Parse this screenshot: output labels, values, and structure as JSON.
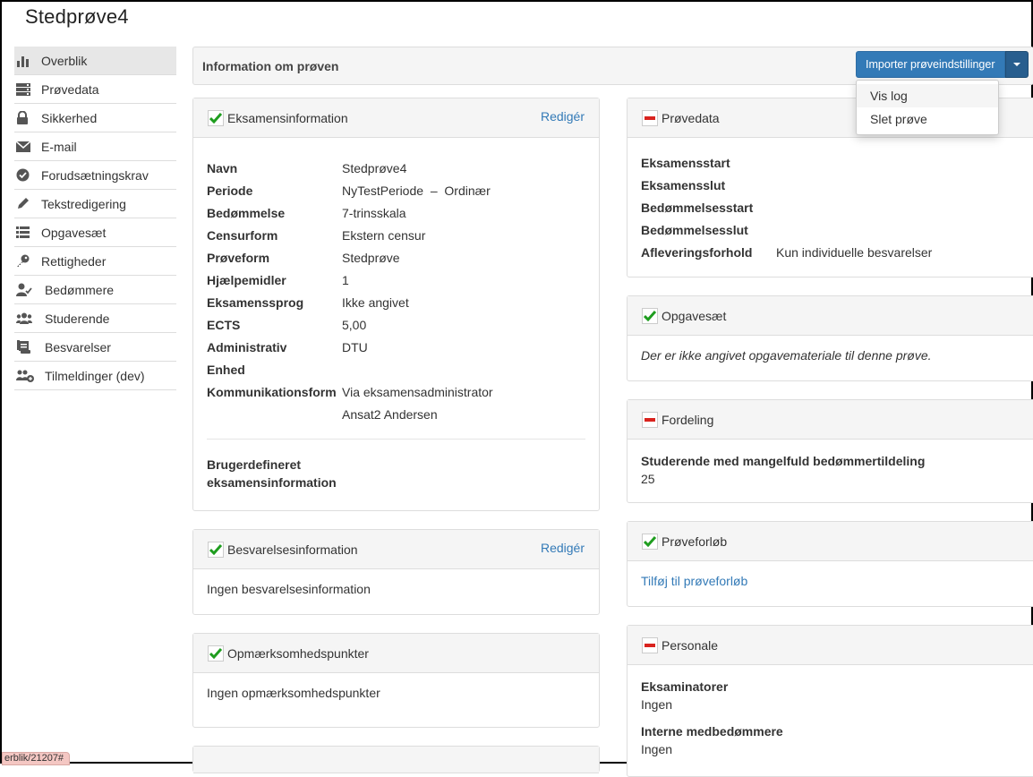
{
  "page": {
    "title": "Stedprøve4"
  },
  "sidebar": {
    "items": [
      {
        "label": "Overblik",
        "icon": "bar-chart-icon",
        "active": true
      },
      {
        "label": "Prøvedata",
        "icon": "server-icon"
      },
      {
        "label": "Sikkerhed",
        "icon": "lock-icon"
      },
      {
        "label": "E-mail",
        "icon": "envelope-icon"
      },
      {
        "label": "Forudsætningskrav",
        "icon": "badge-icon"
      },
      {
        "label": "Tekstredigering",
        "icon": "pencil-icon"
      },
      {
        "label": "Opgavesæt",
        "icon": "list-icon"
      },
      {
        "label": "Rettigheder",
        "icon": "key-icon"
      },
      {
        "label": "Bedømmere",
        "icon": "user-check-icon"
      },
      {
        "label": "Studerende",
        "icon": "users-icon"
      },
      {
        "label": "Besvarelser",
        "icon": "scroll-icon"
      },
      {
        "label": "Tilmeldinger (dev)",
        "icon": "users-plus-icon"
      }
    ]
  },
  "info_bar": {
    "title": "Information om prøven",
    "import_button": "Importer prøveindstillinger"
  },
  "dropdown": {
    "items": [
      "Vis log",
      "Slet prøve"
    ]
  },
  "exam_info": {
    "title": "Eksamensinformation",
    "edit": "Redigér",
    "rows": [
      {
        "k": "Navn",
        "v": "Stedprøve4"
      },
      {
        "k": "Periode",
        "v": "NyTestPeriode  –  Ordinær"
      },
      {
        "k": "Bedømmelse",
        "v": "7-trinsskala"
      },
      {
        "k": "Censurform",
        "v": "Ekstern censur"
      },
      {
        "k": "Prøveform",
        "v": "Stedprøve"
      },
      {
        "k": "Hjælpemidler",
        "v": "1"
      },
      {
        "k": "Eksamenssprog",
        "v": "Ikke angivet"
      },
      {
        "k": "ECTS",
        "v": "5,00"
      }
    ],
    "admin_label_1": "Administrativ",
    "admin_label_2": "Enhed",
    "admin_value": "DTU",
    "comm_label": "Kommunikationsform",
    "comm_value_1": "Via eksamensadministrator",
    "comm_value_2": "Ansat2 Andersen",
    "custom_label_1": "Brugerdefineret",
    "custom_label_2": "eksamensinformation"
  },
  "submission_info": {
    "title": "Besvarelsesinformation",
    "edit": "Redigér",
    "body": "Ingen besvarelsesinformation"
  },
  "attention": {
    "title": "Opmærksomhedspunkter",
    "body": "Ingen opmærksomhedspunkter"
  },
  "test_data": {
    "title": "Prøvedata",
    "rows": [
      {
        "k": "Eksamensstart",
        "v": ""
      },
      {
        "k": "Eksamensslut",
        "v": ""
      },
      {
        "k": "Bedømmelsesstart",
        "v": ""
      },
      {
        "k": "Bedømmelsesslut",
        "v": ""
      },
      {
        "k": "Afleveringsforhold",
        "v": "Kun individuelle besvarelser"
      }
    ]
  },
  "task_set": {
    "title": "Opgavesæt",
    "body": "Der er ikke angivet opgavemateriale til denne prøve."
  },
  "distribution": {
    "title": "Fordeling",
    "label": "Studerende med mangelfuld bedømmertildeling",
    "value": "25"
  },
  "course": {
    "title": "Prøveforløb",
    "link": "Tilføj til prøveforløb"
  },
  "staff": {
    "title": "Personale",
    "examiners_label": "Eksaminatorer",
    "examiners_value": "Ingen",
    "internal_label": "Interne medbedømmere",
    "internal_value": "Ingen"
  },
  "status_bar": {
    "url": "erblik/21207#"
  },
  "colors": {
    "primary": "#337ab7",
    "ok": "#1f9d1f",
    "missing": "#d9231e"
  }
}
